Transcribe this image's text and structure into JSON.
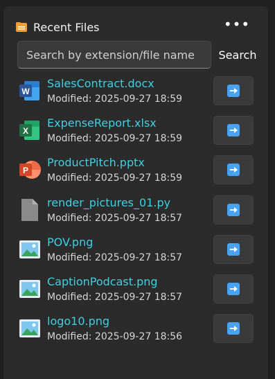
{
  "header": {
    "title": "Recent Files",
    "more_label": "•••"
  },
  "search": {
    "placeholder": "Search by extension/file name",
    "value": "",
    "button_label": "Search"
  },
  "files": [
    {
      "name": "SalesContract.docx",
      "modified": "Modified: 2025-09-27 18:59",
      "icon": "word-icon"
    },
    {
      "name": "ExpenseReport.xlsx",
      "modified": "Modified: 2025-09-27 18:59",
      "icon": "excel-icon"
    },
    {
      "name": "ProductPitch.pptx",
      "modified": "Modified: 2025-09-27 18:59",
      "icon": "powerpoint-icon"
    },
    {
      "name": "render_pictures_01.py",
      "modified": "Modified: 2025-09-27 18:57",
      "icon": "generic-file-icon"
    },
    {
      "name": "POV.png",
      "modified": "Modified: 2025-09-27 18:57",
      "icon": "image-icon"
    },
    {
      "name": "CaptionPodcast.png",
      "modified": "Modified: 2025-09-27 18:57",
      "icon": "image-icon"
    },
    {
      "name": "logo10.png",
      "modified": "Modified: 2025-09-27 18:56",
      "icon": "image-icon"
    }
  ],
  "colors": {
    "file_name": "#3fd0e2",
    "word": "#2b579a",
    "excel": "#217346",
    "powerpoint": "#d24726",
    "folder": "#f0a030"
  }
}
